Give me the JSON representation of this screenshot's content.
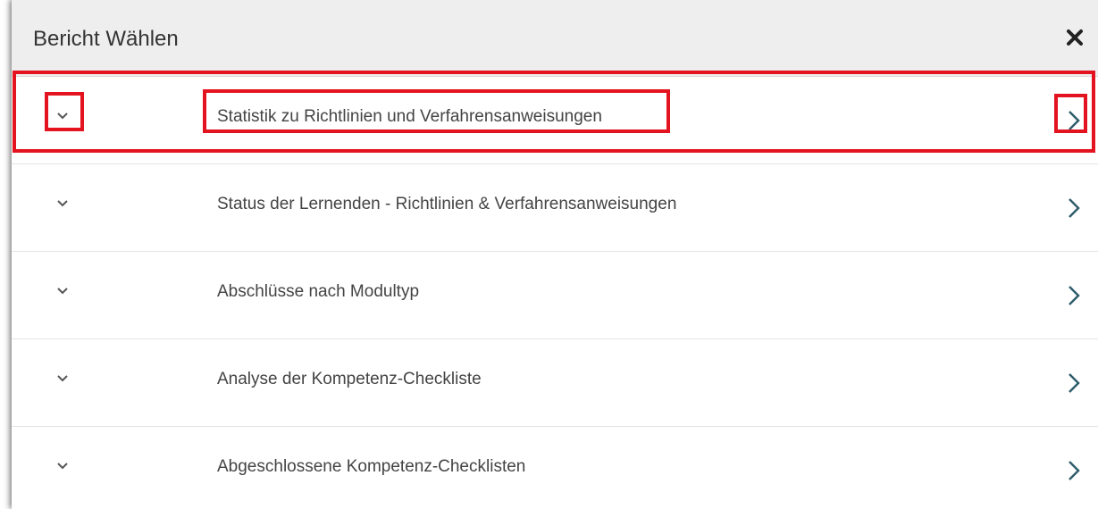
{
  "dialog": {
    "title": "Bericht Wählen",
    "close_icon": "close-icon"
  },
  "reports": [
    {
      "label": "Statistik zu Richtlinien und Verfahrensanweisungen",
      "highlighted": true
    },
    {
      "label": "Status der Lernenden - Richtlinien & Verfahrensanweisungen",
      "highlighted": false
    },
    {
      "label": "Abschlüsse nach Modultyp",
      "highlighted": false
    },
    {
      "label": "Analyse der Kompetenz-Checkliste",
      "highlighted": false
    },
    {
      "label": "Abgeschlossene Kompetenz-Checklisten",
      "highlighted": false
    }
  ],
  "icons": {
    "expand": "chevron-down-icon",
    "open": "chevron-right-icon"
  },
  "colors": {
    "highlight": "#e3141f",
    "chevron": "#2f5d6b",
    "header_bg": "#eeeeee"
  }
}
